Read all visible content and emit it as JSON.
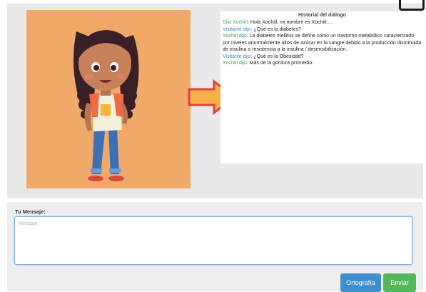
{
  "history": {
    "title": "Historial del diálogo",
    "messages": [
      {
        "speaker": "Dijo Xochitl:",
        "text": "Hola Xochitl, mi nombre es Xochitl....",
        "role": "agent"
      },
      {
        "speaker": "Visitante dijo:",
        "text": "¿Qué es la diabetes?",
        "role": "visitor"
      },
      {
        "speaker": "Xochitl dijo:",
        "text": "La diabetes mellitus se define como un trastorno metabólico caracterizado por niveles anormalmente altos de azúcar en la sangre debido a la producción disminuida de insulina o resistencia a la insulina / desensibilización.",
        "role": "agent"
      },
      {
        "speaker": "Visitante dijo:",
        "text": "¿Qué es la Obesidad?",
        "role": "visitor"
      },
      {
        "speaker": "Xochitl dijo:",
        "text": "Más de la gordura promedio.",
        "role": "agent"
      }
    ]
  },
  "compose": {
    "label": "Tu Mensaje:",
    "placeholder": "Mensaje",
    "value": ""
  },
  "buttons": {
    "spell": "Ortografía",
    "send": "Enviar"
  },
  "colors": {
    "agent_speaker": "#3ba24d",
    "visitor_speaker": "#4a86c5",
    "avatar_bg": "#f0a968",
    "arrow_fill": "#f8b14a",
    "arrow_stroke": "#e2403a"
  }
}
